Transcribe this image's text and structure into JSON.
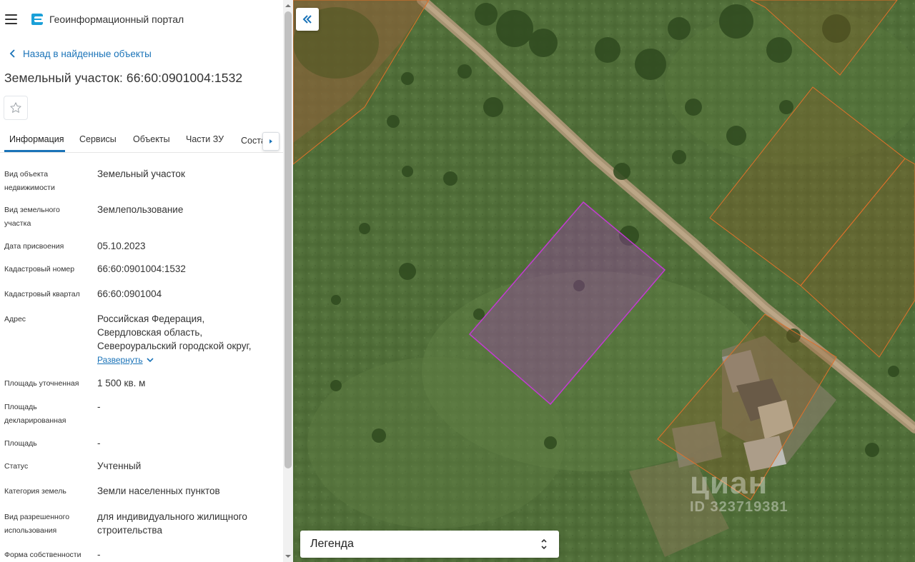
{
  "header": {
    "portal_title": "Геоинформационный портал"
  },
  "nav": {
    "back_label": "Назад в найденные объекты"
  },
  "object": {
    "title": "Земельный участок: 66:60:0901004:1532"
  },
  "tabs": [
    {
      "label": "Информация",
      "active": true
    },
    {
      "label": "Сервисы",
      "active": false
    },
    {
      "label": "Объекты",
      "active": false
    },
    {
      "label": "Части ЗУ",
      "active": false
    },
    {
      "label": "Состав",
      "active": false
    }
  ],
  "info": {
    "rows": [
      {
        "label_lines": [
          "Вид объекта",
          "недвижимости"
        ],
        "value_lines": [
          "Земельный участок"
        ]
      },
      {
        "label_lines": [
          "Вид земельного",
          "участка"
        ],
        "value_lines": [
          "Землепользование"
        ]
      },
      {
        "label_lines": [
          "Дата присвоения"
        ],
        "value_lines": [
          "05.10.2023"
        ]
      },
      {
        "label_lines": [
          "Кадастровый номер"
        ],
        "value_lines": [
          "66:60:0901004:1532"
        ]
      },
      {
        "label_lines": [
          "Кадастровый квартал"
        ],
        "value_lines": [
          "66:60:0901004"
        ]
      },
      {
        "label_lines": [
          "Адрес"
        ],
        "value_lines": [
          "Российская Федерация,",
          "Свердловская область,",
          "Североуральский городской округ,"
        ]
      },
      {
        "label_lines": [
          "Площадь уточненная"
        ],
        "value_lines": [
          "1 500 кв. м"
        ]
      },
      {
        "label_lines": [
          "Площадь",
          "декларированная"
        ],
        "value_lines": [
          "-"
        ]
      },
      {
        "label_lines": [
          "Площадь"
        ],
        "value_lines": [
          "-"
        ]
      },
      {
        "label_lines": [
          "Статус"
        ],
        "value_lines": [
          "Учтенный"
        ]
      },
      {
        "label_lines": [
          "Категория земель"
        ],
        "value_lines": [
          "Земли населенных пунктов"
        ]
      },
      {
        "label_lines": [
          "Вид разрешенного",
          "использования"
        ],
        "value_lines": [
          "для индивидуального жилищного",
          "строительства"
        ]
      },
      {
        "label_lines": [
          "Форма собственности"
        ],
        "value_lines": [
          "-"
        ]
      }
    ],
    "expand_label": "Развернуть"
  },
  "map": {
    "legend_label": "Легенда",
    "watermark_brand": "циан",
    "watermark_id": "ID 323719381",
    "selected_parcel_color": "#c23bd1",
    "other_parcel_color": "#e0702a"
  },
  "icons": {
    "menu": "hamburger-icon",
    "logo": "portal-logo-icon",
    "back": "chevron-left-icon",
    "favorite": "star-outline-icon",
    "tabs_next": "caret-right-icon",
    "expand": "chevron-down-icon",
    "collapse_panel": "double-chevron-left-icon",
    "legend_toggle": "up-down-chevron-icon"
  },
  "colors": {
    "accent": "#1a73b8",
    "text": "#333333"
  }
}
